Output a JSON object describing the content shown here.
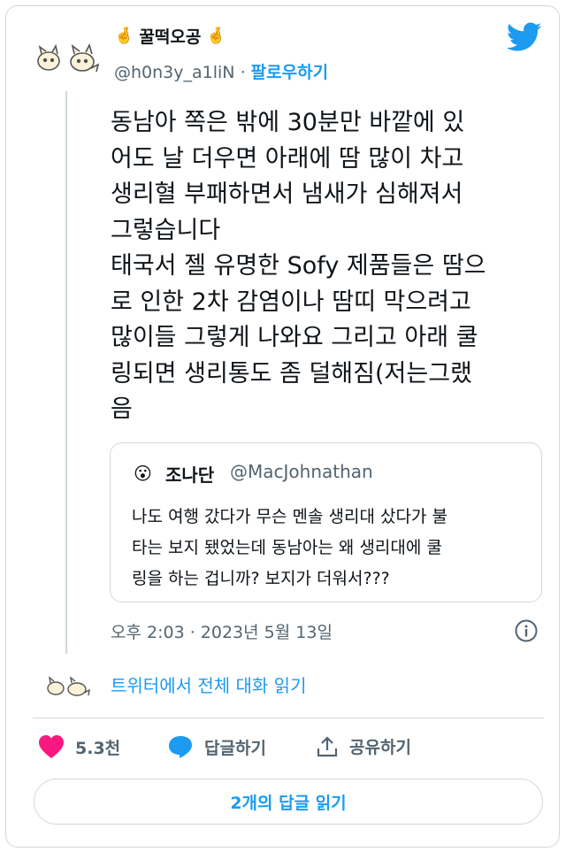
{
  "author": {
    "name": "꿀떡오공",
    "handle": "@h0n3y_a1liN",
    "separator": "·",
    "follow_label": "팔로우하기"
  },
  "tweet": {
    "text": "동남아 쪽은 밖에 30분만 바깥에 있\n어도 날 더우면 아래에 땀 많이 차고\n생리혈 부패하면서 냄새가 심해져서\n그렇습니다\n태국서 젤 유명한 Sofy 제품들은 땀으\n로 인한 2차 감염이나 땀띠 막으려고\n많이들 그렇게 나와요 그리고 아래 쿨\n링되면 생리통도 좀 덜해짐(저는그랬\n음",
    "timestamp": "오후 2:03 · 2023년 5월 13일"
  },
  "quote": {
    "name": "조나단",
    "handle": "@MacJohnathan",
    "text": "나도 여행 갔다가 무슨 멘솔 생리대 샀다가 불\n타는 보지 됐었는데 동남아는 왜 생리대에 쿨\n링을 하는 겁니까? 보지가 더워서???"
  },
  "read_conversation_label": "트위터에서 전체 대화 읽기",
  "actions": {
    "like_count": "5.3천",
    "reply_label": "답글하기",
    "share_label": "공유하기"
  },
  "read_replies_label": "2개의 답글 읽기",
  "colors": {
    "accent": "#1d9bf0",
    "like": "#f91880",
    "muted": "#536471",
    "border": "#cfd9de"
  }
}
